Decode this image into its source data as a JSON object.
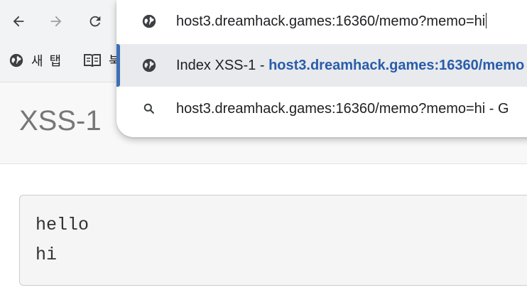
{
  "browser": {
    "address_input": "host3.dreamhack.games:16360/memo?memo=hi",
    "bookmarks": [
      {
        "label": "새 탭",
        "icon": "globe-icon"
      },
      {
        "label": "북",
        "icon": "book-icon"
      }
    ],
    "suggestions": [
      {
        "prefix": "Index XSS-1 - ",
        "url": "host3.dreamhack.games:16360/memo",
        "icon": "globe-icon"
      },
      {
        "text": "host3.dreamhack.games:16360/memo?memo=hi - G",
        "icon": "search-icon"
      }
    ]
  },
  "page": {
    "site_title": "XSS-1",
    "memo_lines": [
      "hello",
      "hi"
    ]
  },
  "colors": {
    "chrome_bg": "#f1f3f4",
    "selected_accent": "#3c6fb7",
    "url_highlight": "#2a5cab",
    "header_bg": "#f8f8f8"
  }
}
